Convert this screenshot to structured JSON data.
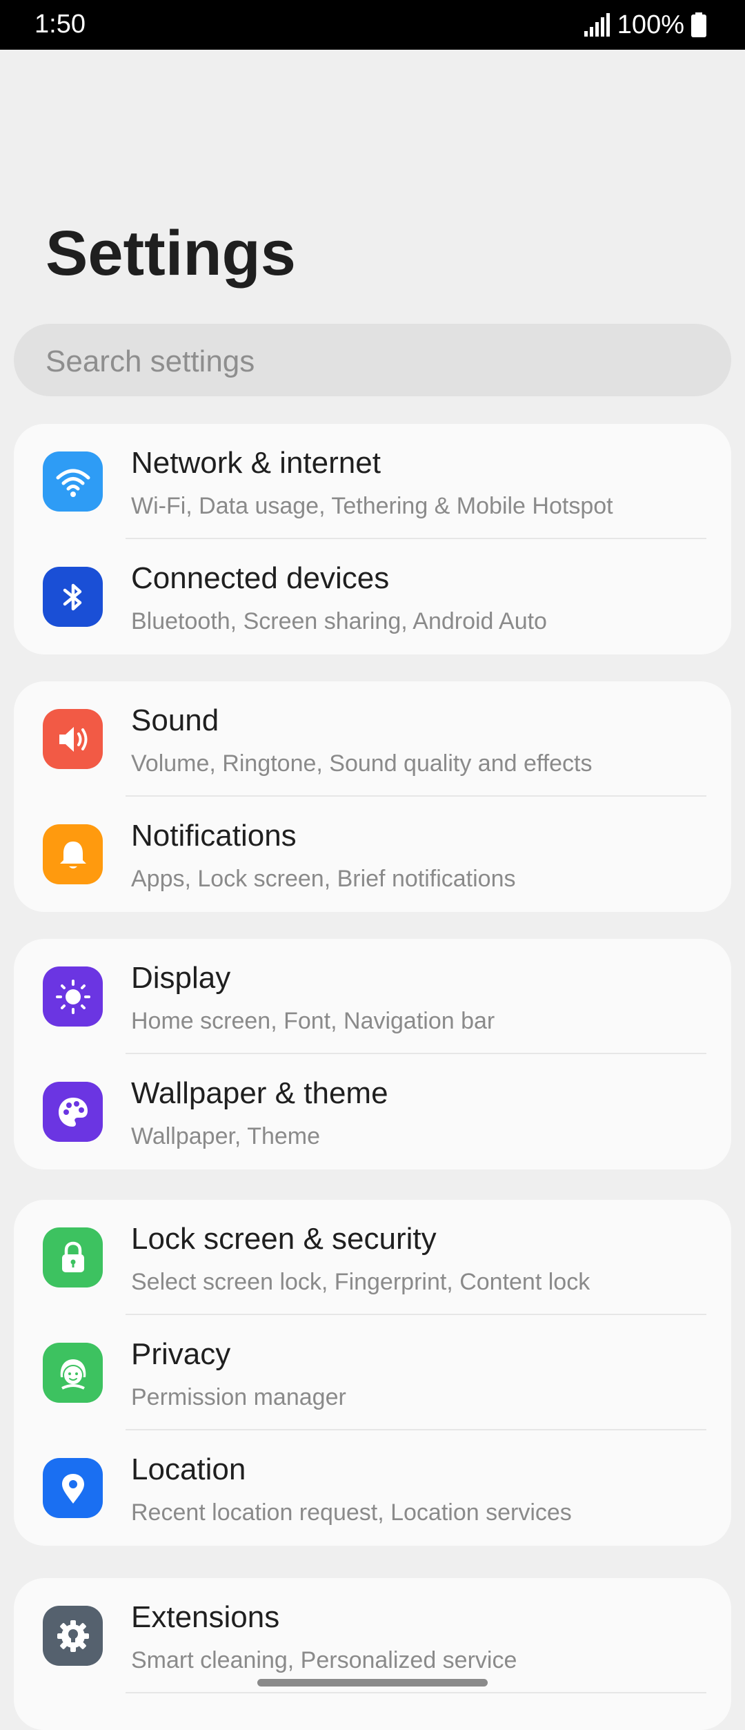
{
  "status_bar": {
    "time": "1:50",
    "battery": "100%"
  },
  "header": {
    "title": "Settings"
  },
  "search": {
    "placeholder": "Search settings"
  },
  "colors": {
    "wifi": "#2e9cf5",
    "bluetooth": "#1a4fd6",
    "sound": "#f25a45",
    "notifications": "#ff9a0e",
    "display": "#6b35e2",
    "wallpaper": "#6b35e2",
    "lock": "#3dc260",
    "privacy": "#3dc260",
    "location": "#1a6ff2",
    "extensions": "#55616e"
  },
  "groups": [
    {
      "items": [
        {
          "title": "Network & internet",
          "subtitle": "Wi-Fi, Data usage, Tethering & Mobile Hotspot",
          "icon": "wifi-icon"
        },
        {
          "title": "Connected devices",
          "subtitle": "Bluetooth, Screen sharing, Android Auto",
          "icon": "bluetooth-icon"
        }
      ]
    },
    {
      "items": [
        {
          "title": "Sound",
          "subtitle": "Volume, Ringtone, Sound quality and effects",
          "icon": "speaker-icon"
        },
        {
          "title": "Notifications",
          "subtitle": "Apps, Lock screen, Brief notifications",
          "icon": "bell-icon"
        }
      ]
    },
    {
      "items": [
        {
          "title": "Display",
          "subtitle": "Home screen, Font, Navigation bar",
          "icon": "brightness-icon"
        },
        {
          "title": "Wallpaper & theme",
          "subtitle": "Wallpaper, Theme",
          "icon": "palette-icon"
        }
      ]
    },
    {
      "items": [
        {
          "title": "Lock screen & security",
          "subtitle": "Select screen lock, Fingerprint, Content lock",
          "icon": "lock-icon"
        },
        {
          "title": "Privacy",
          "subtitle": "Permission manager",
          "icon": "privacy-face-icon"
        },
        {
          "title": "Location",
          "subtitle": "Recent location request, Location services",
          "icon": "location-pin-icon"
        }
      ]
    },
    {
      "items": [
        {
          "title": "Extensions",
          "subtitle": "Smart cleaning, Personalized service",
          "icon": "gear-bulb-icon"
        }
      ]
    }
  ]
}
